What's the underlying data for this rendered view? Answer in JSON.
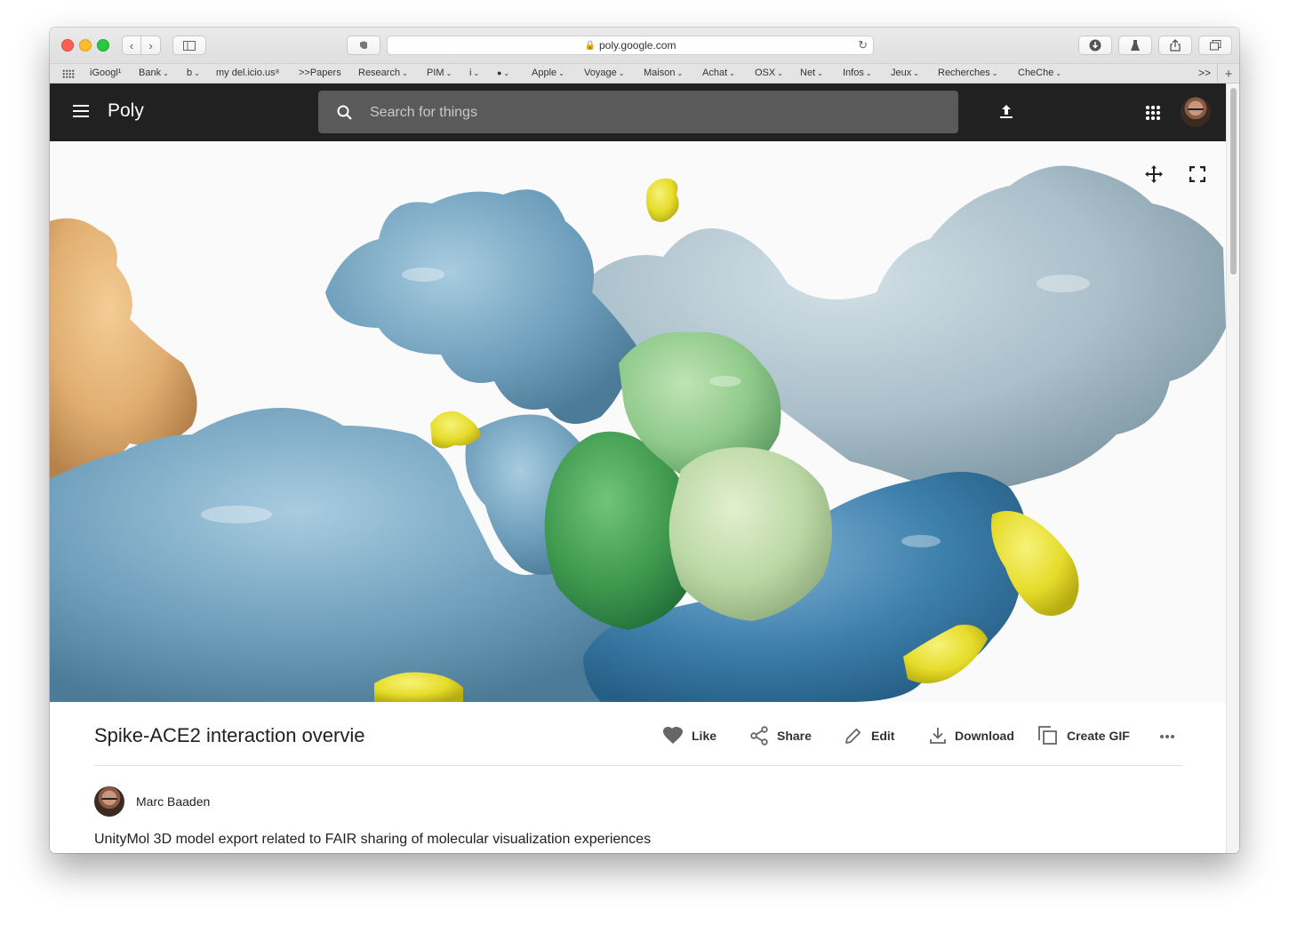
{
  "browser": {
    "url": "poly.google.com",
    "bookmarks": [
      {
        "label": "iGoogl¹",
        "menu": false
      },
      {
        "label": "Bank",
        "menu": true
      },
      {
        "label": "b",
        "menu": true
      },
      {
        "label": "my del.icio.us⁸",
        "menu": false
      },
      {
        "label": ">>Papers",
        "menu": false
      },
      {
        "label": "Research",
        "menu": true
      },
      {
        "label": "PIM",
        "menu": true
      },
      {
        "label": "i",
        "menu": true
      },
      {
        "label": "",
        "menu": true
      },
      {
        "label": "Apple",
        "menu": true
      },
      {
        "label": "Voyage",
        "menu": true
      },
      {
        "label": "Maison",
        "menu": true
      },
      {
        "label": "Achat",
        "menu": true
      },
      {
        "label": "OSX",
        "menu": true
      },
      {
        "label": "Net",
        "menu": true
      },
      {
        "label": "Infos",
        "menu": true
      },
      {
        "label": "Jeux",
        "menu": true
      },
      {
        "label": "Recherches",
        "menu": true
      },
      {
        "label": "CheChe",
        "menu": true
      }
    ],
    "overflow_label": ">>"
  },
  "app": {
    "logo": "Poly",
    "search_placeholder": "Search for things"
  },
  "asset": {
    "title": "Spike-ACE2 interaction overvie",
    "actions": {
      "like": "Like",
      "share": "Share",
      "edit": "Edit",
      "download": "Download",
      "create_gif": "Create GIF"
    },
    "author": "Marc Baaden",
    "description": "UnityMol 3D model export related to FAIR sharing of molecular visualization experiences"
  },
  "colors": {
    "appbar": "#212121",
    "search_bg": "#5a5a5a",
    "protein_blue": "#6f9fbc",
    "protein_pale_blue": "#a9bfca",
    "protein_deep_blue": "#3d7fab",
    "protein_green": "#3f9a4e",
    "protein_light_green": "#8fc98a",
    "protein_pale_green": "#bcd8a5",
    "protein_tan": "#e0ad6f",
    "glycan_yellow": "#e6dc2a"
  },
  "icons": [
    "menu-icon",
    "search-icon",
    "upload-icon",
    "apps-icon",
    "move-icon",
    "fullscreen-icon",
    "heart-icon",
    "share-icon",
    "pencil-icon",
    "download-icon",
    "copy-icon",
    "more-icon"
  ]
}
